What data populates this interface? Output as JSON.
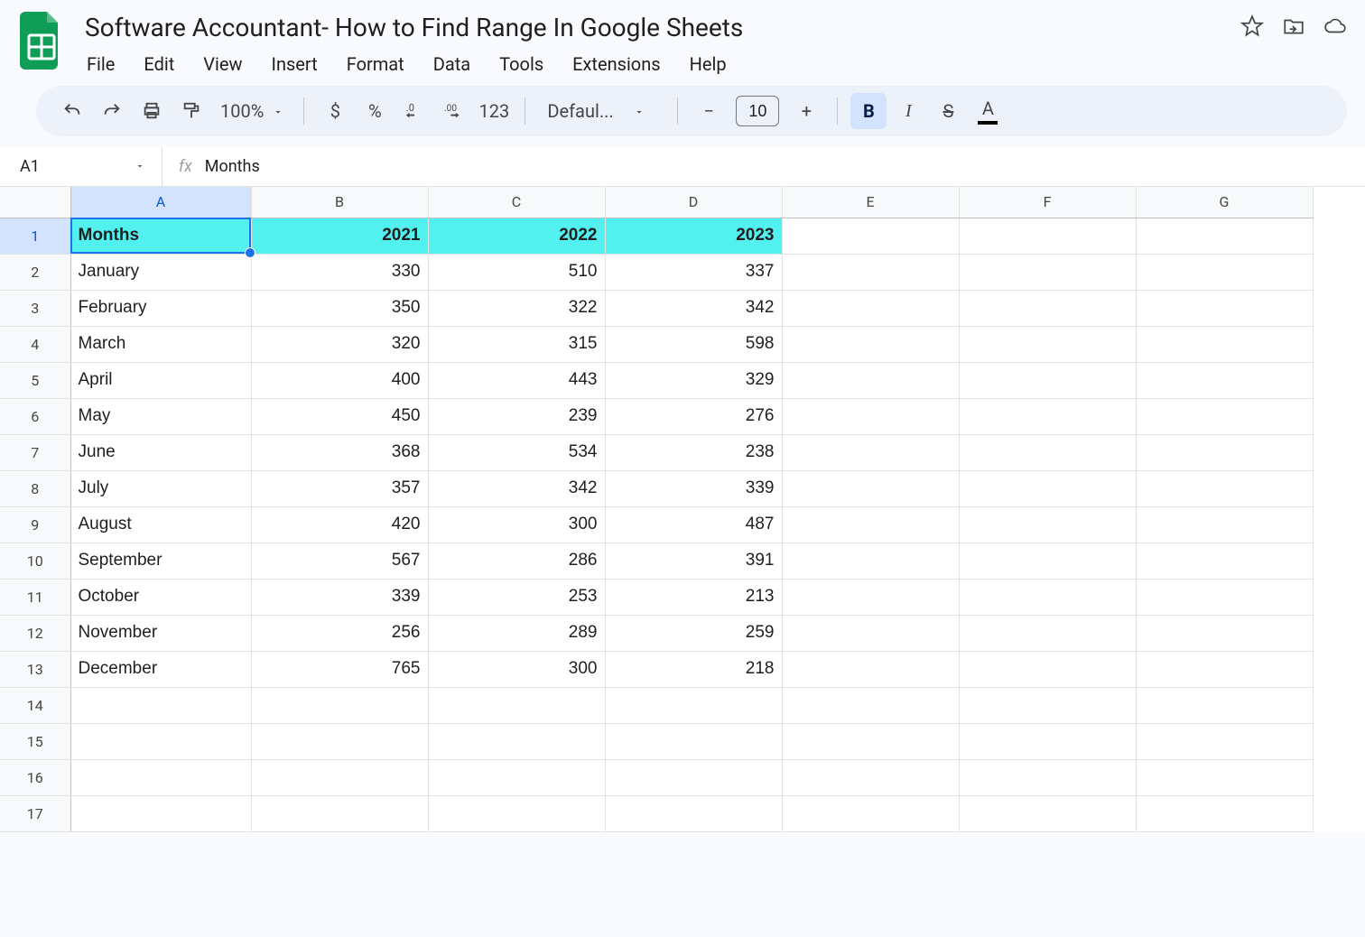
{
  "doc_title": "Software Accountant- How to Find Range In Google Sheets",
  "menus": [
    "File",
    "Edit",
    "View",
    "Insert",
    "Format",
    "Data",
    "Tools",
    "Extensions",
    "Help"
  ],
  "toolbar": {
    "zoom": "100%",
    "font": "Defaul...",
    "font_size": "10",
    "num_label": "123"
  },
  "name_box": "A1",
  "fx_label": "fx",
  "formula_value": "Months",
  "columns": [
    "A",
    "B",
    "C",
    "D",
    "E",
    "F",
    "G"
  ],
  "selected_col": "A",
  "selected_row": 1,
  "total_rows": 17,
  "sheet": {
    "headers": [
      "Months",
      "2021",
      "2022",
      "2023"
    ],
    "rows": [
      [
        "January",
        330,
        510,
        337
      ],
      [
        "February",
        350,
        322,
        342
      ],
      [
        "March",
        320,
        315,
        598
      ],
      [
        "April",
        400,
        443,
        329
      ],
      [
        "May",
        450,
        239,
        276
      ],
      [
        "June",
        368,
        534,
        238
      ],
      [
        "July",
        357,
        342,
        339
      ],
      [
        "August",
        420,
        300,
        487
      ],
      [
        "September",
        567,
        286,
        391
      ],
      [
        "October",
        339,
        253,
        213
      ],
      [
        "November",
        256,
        289,
        259
      ],
      [
        "December",
        765,
        300,
        218
      ]
    ]
  }
}
